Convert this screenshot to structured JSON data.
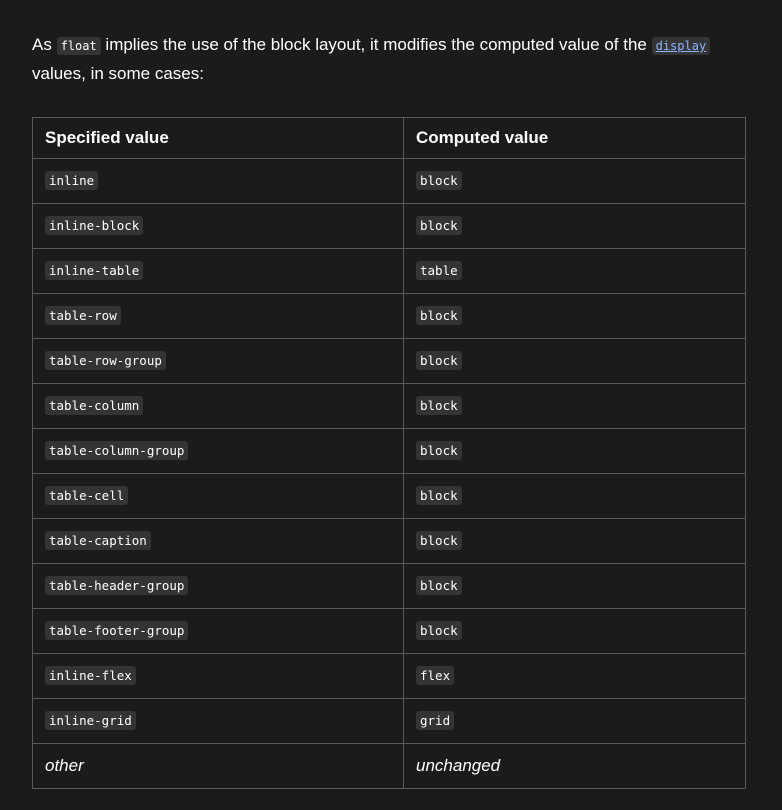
{
  "intro": {
    "before": "As ",
    "code1": "float",
    "middle": " implies the use of the block layout, it modifies the computed value of the ",
    "link_code": "display",
    "after": " values, in some cases:"
  },
  "table": {
    "headers": [
      "Specified value",
      "Computed value"
    ],
    "rows": [
      {
        "specified": "inline",
        "computed": "block"
      },
      {
        "specified": "inline-block",
        "computed": "block"
      },
      {
        "specified": "inline-table",
        "computed": "table"
      },
      {
        "specified": "table-row",
        "computed": "block"
      },
      {
        "specified": "table-row-group",
        "computed": "block"
      },
      {
        "specified": "table-column",
        "computed": "block"
      },
      {
        "specified": "table-column-group",
        "computed": "block"
      },
      {
        "specified": "table-cell",
        "computed": "block"
      },
      {
        "specified": "table-caption",
        "computed": "block"
      },
      {
        "specified": "table-header-group",
        "computed": "block"
      },
      {
        "specified": "table-footer-group",
        "computed": "block"
      },
      {
        "specified": "inline-flex",
        "computed": "flex"
      },
      {
        "specified": "inline-grid",
        "computed": "grid"
      },
      {
        "specified": "other",
        "computed": "unchanged"
      }
    ]
  },
  "colors": {
    "background": "#1b1b1b",
    "code_background": "#343434",
    "link": "#8cb4ff",
    "border": "#5a5a5a"
  }
}
